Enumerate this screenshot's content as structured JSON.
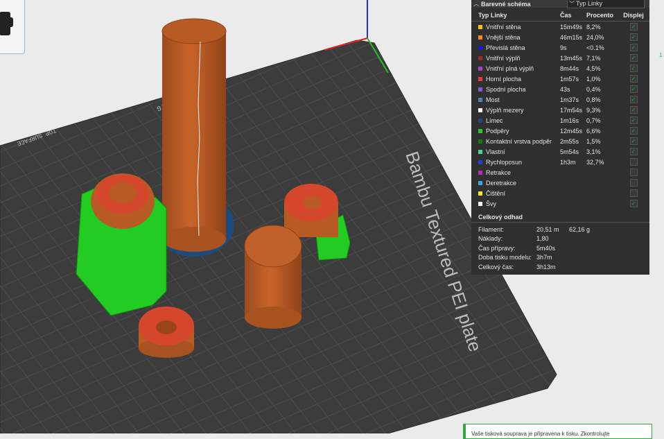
{
  "panel": {
    "title": "Barevné schéma",
    "view_select": "Typ Linky",
    "columns": {
      "name": "Typ Linky",
      "time": "Čas",
      "percent": "Procento",
      "display": "Displej"
    },
    "rows": [
      {
        "name": "Vnitřní stěna",
        "time": "15m49s",
        "pct": "8,2%",
        "color": "#f5c518",
        "checked": true
      },
      {
        "name": "Vnější stěna",
        "time": "46m15s",
        "pct": "24,0%",
        "color": "#f08a2b",
        "checked": true
      },
      {
        "name": "Převislá stěna",
        "time": "9s",
        "pct": "<0.1%",
        "color": "#1a1ad9",
        "checked": true
      },
      {
        "name": "Vnitřní výplň",
        "time": "13m45s",
        "pct": "7,1%",
        "color": "#9c2a2a",
        "checked": true
      },
      {
        "name": "Vnitřní plná výplň",
        "time": "8m44s",
        "pct": "4,5%",
        "color": "#a045c8",
        "checked": true
      },
      {
        "name": "Horní plocha",
        "time": "1m57s",
        "pct": "1,0%",
        "color": "#e23b3b",
        "checked": true
      },
      {
        "name": "Spodní plocha",
        "time": "43s",
        "pct": "0,4%",
        "color": "#7a5fd0",
        "checked": true
      },
      {
        "name": "Most",
        "time": "1m37s",
        "pct": "0,8%",
        "color": "#4a7fb8",
        "checked": true
      },
      {
        "name": "Výplň mezery",
        "time": "17m54s",
        "pct": "9,3%",
        "color": "#ffffff",
        "checked": true
      },
      {
        "name": "Límec",
        "time": "1m16s",
        "pct": "0,7%",
        "color": "#1f4a7a",
        "checked": true
      },
      {
        "name": "Podpěry",
        "time": "12m45s",
        "pct": "6,6%",
        "color": "#22cc22",
        "checked": true
      },
      {
        "name": "Kontaktní vrstva podpěr",
        "time": "2m55s",
        "pct": "1,5%",
        "color": "#127a12",
        "checked": true
      },
      {
        "name": "Vlastní",
        "time": "5m54s",
        "pct": "3,1%",
        "color": "#4fd18f",
        "checked": true
      },
      {
        "name": "Rychloposun",
        "time": "1h3m",
        "pct": "32,7%",
        "color": "#2d3bd4",
        "checked": false
      },
      {
        "name": "Retrakce",
        "time": "",
        "pct": "",
        "color": "#b030b0",
        "checked": false
      },
      {
        "name": "Deretrakce",
        "time": "",
        "pct": "",
        "color": "#3fa7d6",
        "checked": false
      },
      {
        "name": "Čištění",
        "time": "",
        "pct": "",
        "color": "#f2e82b",
        "checked": false
      },
      {
        "name": "Švy",
        "time": "",
        "pct": "",
        "color": "#f2f2f2",
        "checked": true
      }
    ]
  },
  "estimate": {
    "title": "Celkový odhad",
    "rows": [
      {
        "label": "Filament:",
        "value": "20,51 m",
        "extra": "62,16 g"
      },
      {
        "label": "Náklady:",
        "value": "1,80",
        "extra": ""
      },
      {
        "label": "Čas přípravy:",
        "value": "5m40s",
        "extra": ""
      },
      {
        "label": "Doba tisku modelu:",
        "value": "3h7m",
        "extra": ""
      },
      {
        "label": "Celkový čas:",
        "value": "3h13m",
        "extra": ""
      }
    ]
  },
  "plate_label": "Bambu Textured PEI plate",
  "plate_small_labels": [
    "02/PETG",
    "TOP SURFACE"
  ],
  "edge_tick": "1",
  "toast": {
    "text": "Vaše tisková souprava je připravena k tisku. Zkontrolujte"
  },
  "icons": {
    "collapse": "chevron-up-icon",
    "dropdown": "chevron-down-icon",
    "check": "check-icon",
    "toolbar": "move-gizmo-icon"
  }
}
